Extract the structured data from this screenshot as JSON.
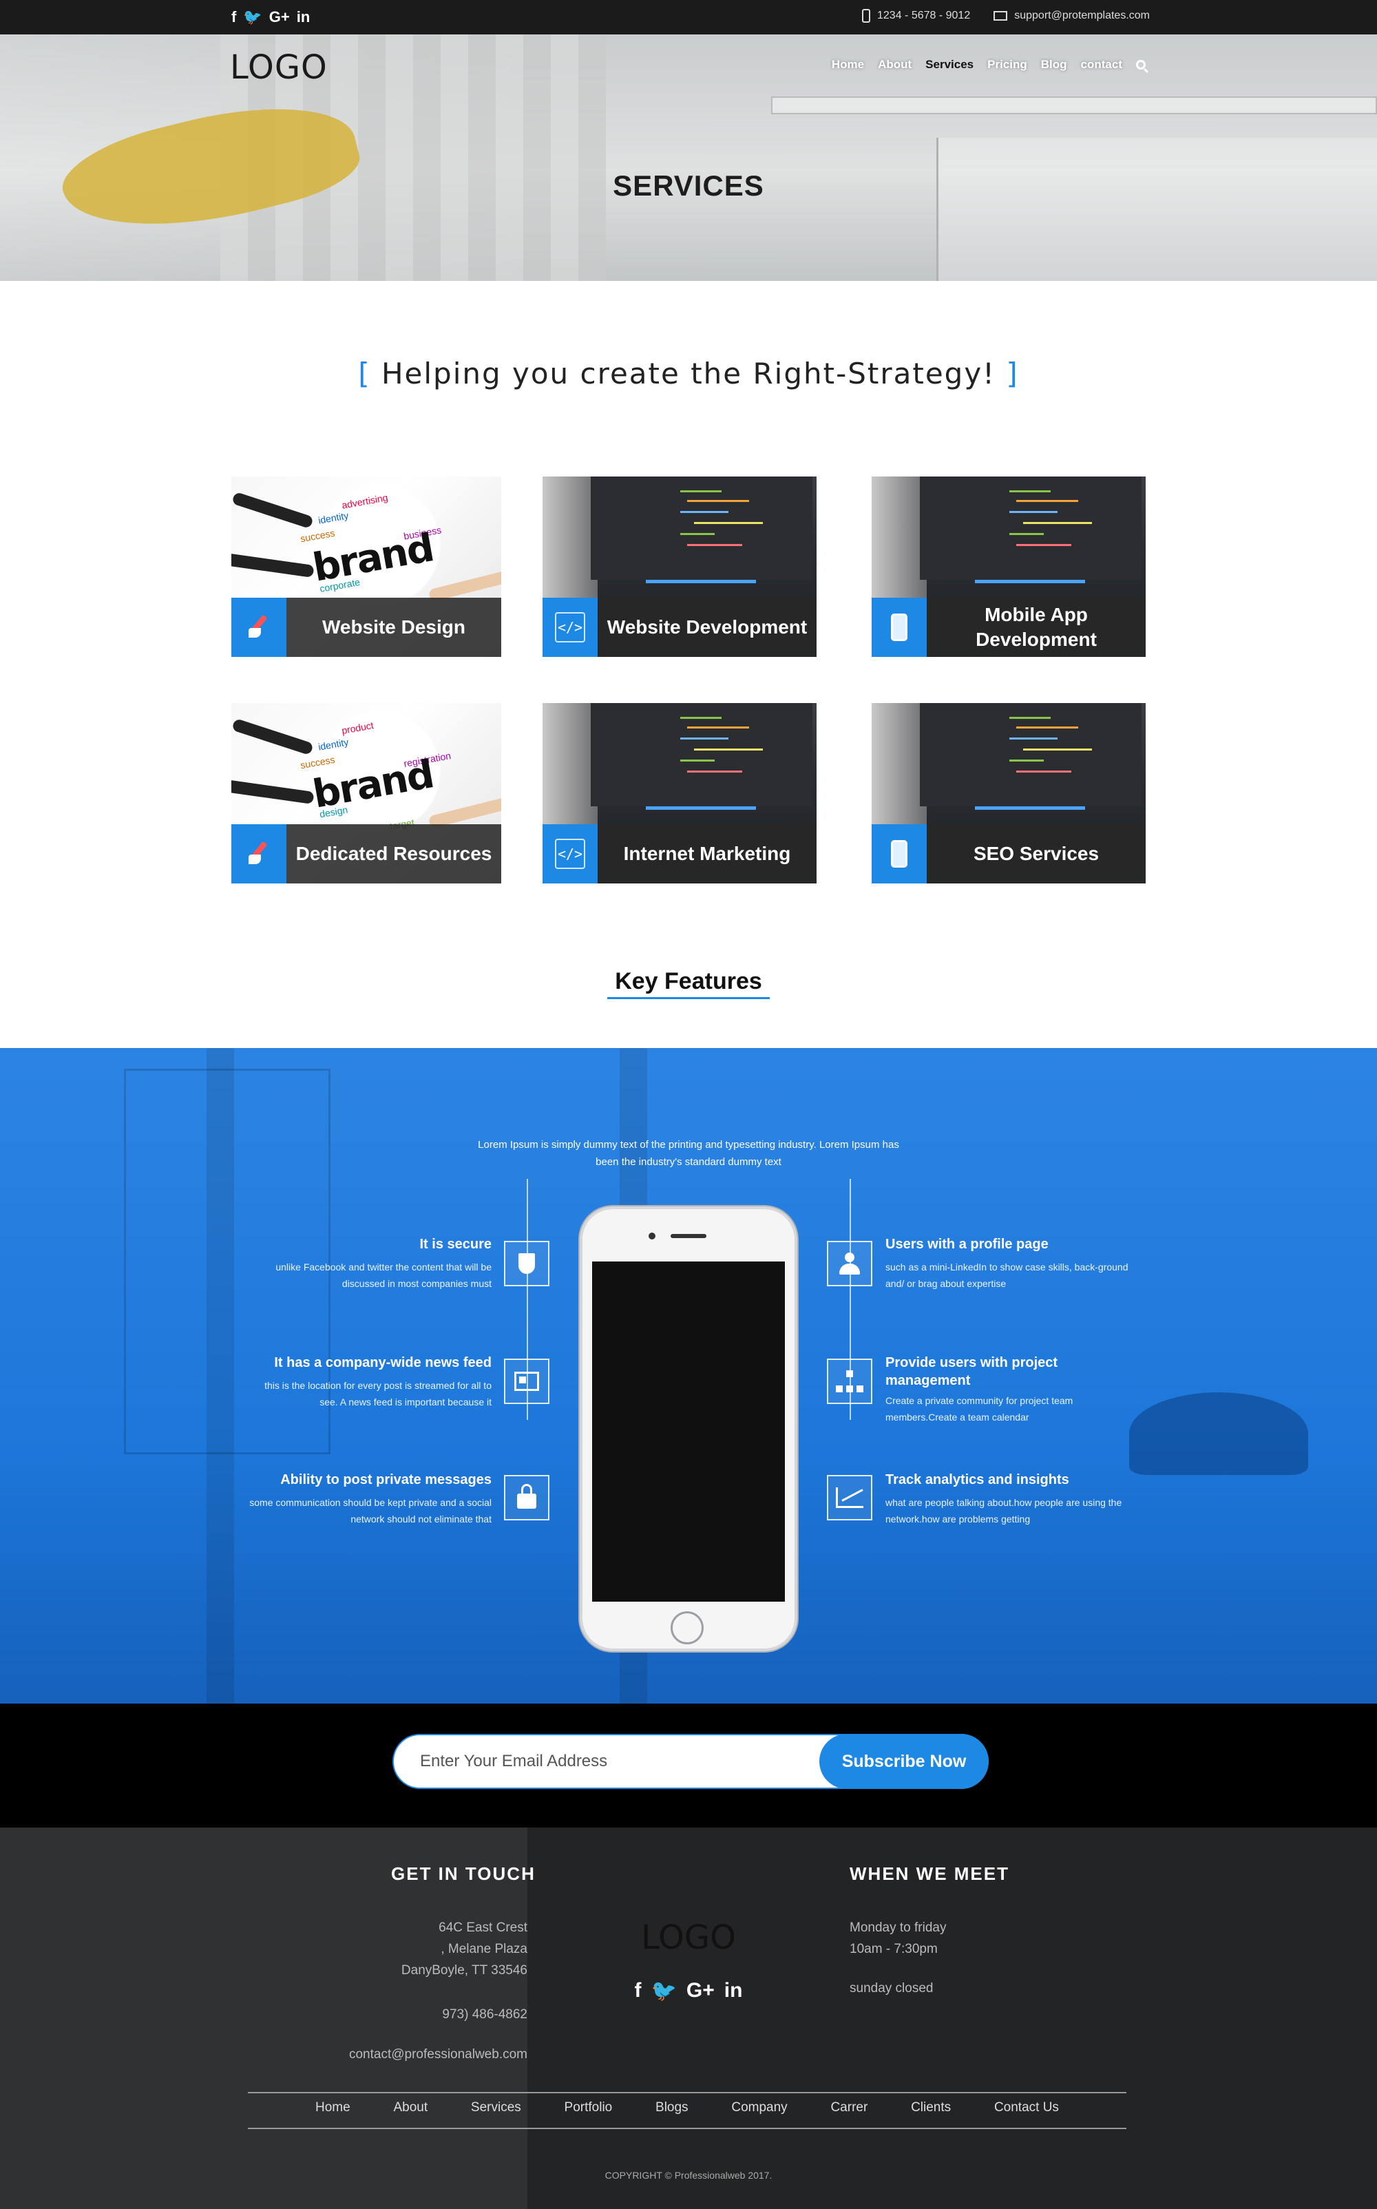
{
  "topbar": {
    "social": [
      "f",
      "t",
      "G+",
      "in"
    ],
    "phone": "1234 - 5678 - 9012",
    "email": "support@protemplates.com"
  },
  "header": {
    "logo": "LOGO",
    "nav": [
      "Home",
      "About",
      "Services",
      "Pricing",
      "Blog",
      "contact"
    ],
    "active": "Services",
    "search_icon": "search-icon"
  },
  "hero": {
    "title": "SERVICES"
  },
  "services": {
    "heading_open": "[",
    "heading": "Helping you create the Right-Strategy!",
    "heading_close": "]",
    "cards": [
      {
        "label": "Website Design",
        "icon": "brush-icon",
        "image": "brand-sketch"
      },
      {
        "label": "Website Development",
        "icon": "code-icon",
        "image": "code-laptop"
      },
      {
        "label": "Mobile App Development",
        "icon": "mobile-phone-icon",
        "image": "code-laptop"
      },
      {
        "label": "Dedicated Resources",
        "icon": "brush-icon",
        "image": "brand-sketch"
      },
      {
        "label": "Internet Marketing",
        "icon": "code-icon",
        "image": "code-laptop"
      },
      {
        "label": "SEO Services",
        "icon": "mobile-phone-icon",
        "image": "code-laptop"
      }
    ],
    "brand_word": "brand",
    "brand_tags": [
      "advertising",
      "identity",
      "success",
      "business",
      "corporate",
      "design",
      "registration",
      "product",
      "target"
    ]
  },
  "key_features": {
    "title": "Key Features",
    "intro": "Lorem Ipsum is simply dummy text of the printing and typesetting industry. Lorem Ipsum has been the industry's standard dummy text",
    "left": [
      {
        "title": "It is secure",
        "desc": "unlike Facebook and twitter the content that will be discussed in most companies must",
        "icon": "shield-icon"
      },
      {
        "title": "It has a company-wide news feed",
        "desc": "this is the location for every post is streamed for all to see.  A news feed is important because it",
        "icon": "newspaper-icon"
      },
      {
        "title": "Ability to post private messages",
        "desc": "some communication should be kept private and a social network should not eliminate that",
        "icon": "lock-icon"
      }
    ],
    "right": [
      {
        "title": "Users with a profile page",
        "desc": "such as a mini-LinkedIn to show case skills, back-ground and/ or brag about expertise",
        "icon": "user-icon"
      },
      {
        "title": "Provide users with project management",
        "desc": "Create a private community for project team members.Create a team calendar",
        "icon": "org-chart-icon"
      },
      {
        "title": "Track analytics and insights",
        "desc": "what are people talking about.how people are using the network.how are problems getting",
        "icon": "line-chart-icon"
      }
    ]
  },
  "newsletter": {
    "placeholder": "Enter Your Email Address",
    "button": "Subscribe Now"
  },
  "footer": {
    "get_in_touch": "GET IN TOUCH",
    "address": [
      "64C East Crest",
      ", Melane Plaza",
      "DanyBoyle, TT 33546"
    ],
    "phone": "973) 486-4862",
    "email": "contact@professionalweb.com",
    "logo": "LOGO",
    "social": [
      "f",
      "t",
      "G+",
      "in"
    ],
    "when_we_meet": "WHEN WE MEET",
    "hours": [
      "Monday to friday",
      "10am - 7:30pm"
    ],
    "closed": "sunday closed",
    "links": [
      "Home",
      "About",
      "Services",
      "Portfolio",
      "Blogs",
      "Company",
      "Carrer",
      "Clients",
      "Contact Us"
    ],
    "copyright": "COPYRIGHT © Professionalweb 2017."
  },
  "colors": {
    "accent": "#1e88e5",
    "topbar": "#1b1b1b",
    "footer": "#2f3133"
  }
}
